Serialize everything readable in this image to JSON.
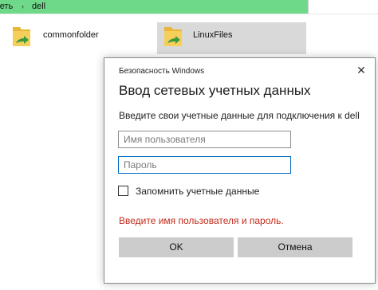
{
  "explorer": {
    "breadcrumb_prev": "ьеть",
    "breadcrumb_sep": "›",
    "breadcrumb_current": "dell",
    "folders": [
      {
        "label": "commonfolder",
        "selected": false
      },
      {
        "label": "LinuxFiles",
        "selected": true
      }
    ]
  },
  "dialog": {
    "caption": "Безопасность Windows",
    "close_icon": "close-icon",
    "heading": "Ввод сетевых учетных данных",
    "subtitle": "Введите свои учетные данные для подключения к dell",
    "username": {
      "value": "",
      "placeholder": "Имя пользователя"
    },
    "password": {
      "value": "",
      "placeholder": "Пароль"
    },
    "remember_label": "Запомнить учетные данные",
    "remember_checked": false,
    "error": "Введите имя пользователя и пароль.",
    "ok_label": "OK",
    "cancel_label": "Отмена"
  },
  "colors": {
    "address_bar": "#6fd98a",
    "error": "#c42b1c",
    "button": "#cccccc",
    "focus_border": "#0067c0"
  }
}
